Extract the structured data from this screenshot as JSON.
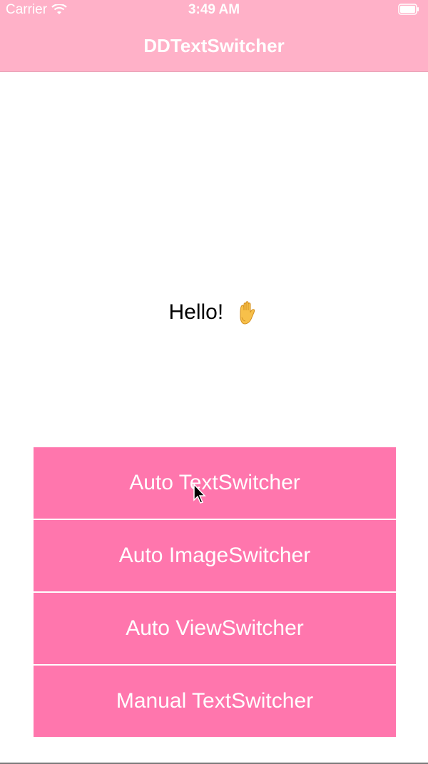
{
  "status_bar": {
    "carrier": "Carrier",
    "time": "3:49 AM",
    "wifi_icon": "wifi-icon",
    "battery_icon": "battery-icon"
  },
  "nav": {
    "title": "DDTextSwitcher"
  },
  "switcher": {
    "text": "Hello!",
    "emoji_icon": "raised-hand-icon"
  },
  "buttons": [
    {
      "label": "Auto TextSwitcher"
    },
    {
      "label": "Auto ImageSwitcher"
    },
    {
      "label": "Auto ViewSwitcher"
    },
    {
      "label": "Manual TextSwitcher"
    }
  ],
  "colors": {
    "nav_background": "#ffb1c8",
    "button_background": "#ff76ad",
    "text_on_color": "#ffffff"
  }
}
